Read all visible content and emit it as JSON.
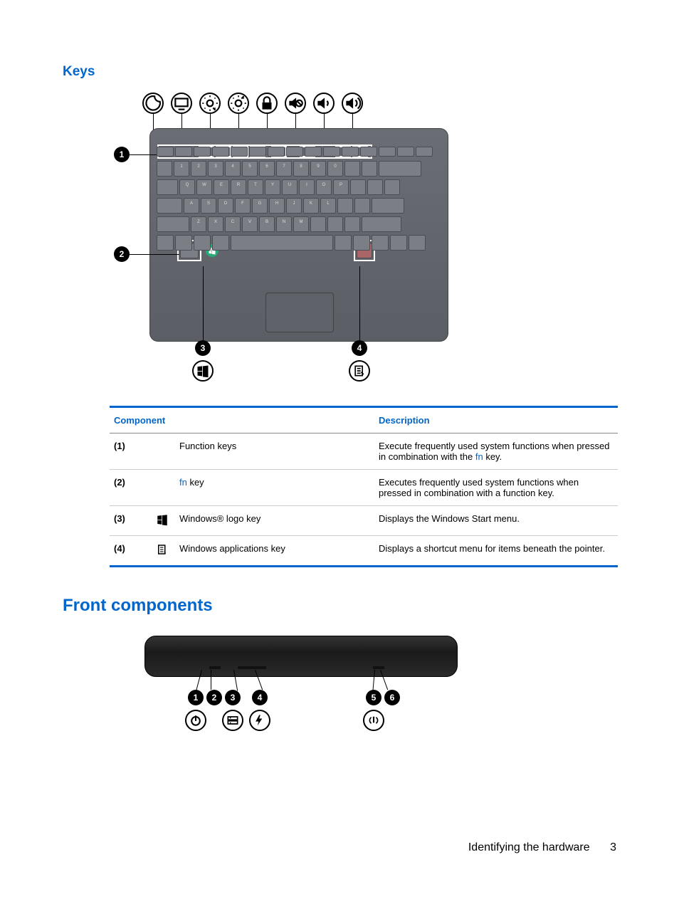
{
  "sections": {
    "keys_heading": "Keys",
    "front_heading": "Front components"
  },
  "table_headers": {
    "component": "Component",
    "description": "Description"
  },
  "keys_table": {
    "rows": [
      {
        "num": "(1)",
        "icon": "",
        "component": "Function keys",
        "desc_pre": "Execute frequently used system functions when pressed in combination with the ",
        "desc_link": "fn",
        "desc_post": " key."
      },
      {
        "num": "(2)",
        "icon": "",
        "comp_link": "fn",
        "comp_post": " key",
        "desc": "Executes frequently used system functions when pressed in combination with a function key."
      },
      {
        "num": "(3)",
        "icon": "windows-logo",
        "component": "Windows® logo key",
        "desc": "Displays the Windows Start menu."
      },
      {
        "num": "(4)",
        "icon": "apps-menu",
        "component": "Windows applications key",
        "desc": "Displays a shortcut menu for items beneath the pointer."
      }
    ]
  },
  "callouts": {
    "c1": "1",
    "c2": "2",
    "c3": "3",
    "c4": "4",
    "c5": "5",
    "c6": "6"
  },
  "footer": {
    "section": "Identifying the hardware",
    "page": "3"
  }
}
